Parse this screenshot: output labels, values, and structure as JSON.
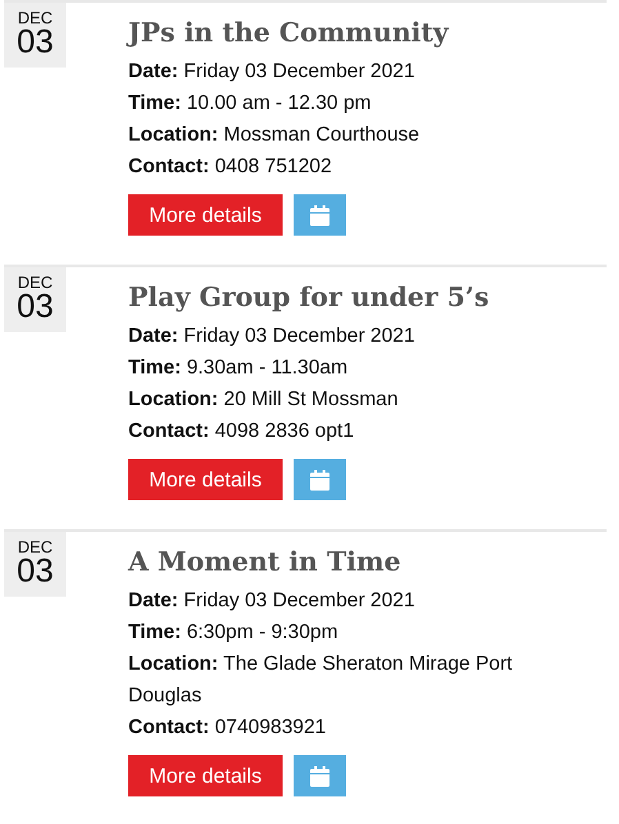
{
  "events": [
    {
      "month": "DEC",
      "day": "03",
      "title": "JPs in the Community",
      "details": [
        "**Date:** Friday 03 December 2021",
        "**Time:** 10.00 am - 12.30 pm",
        "**Location:** Mossman Courthouse",
        "**Contact:** 0408 751202"
      ],
      "button": "More details"
    },
    {
      "month": "DEC",
      "day": "03",
      "title": "Play Group for under 5’s",
      "details": [
        "**Date:** Friday 03 December 2021",
        "**Time:** 9.30am - 11.30am",
        "**Location:** 20 Mill St Mossman",
        "**Contact:** 4098 2836 opt1"
      ],
      "button": "More details"
    },
    {
      "month": "DEC",
      "day": "03",
      "title": "A Moment in Time",
      "details": [
        "**Date:** Friday 03 December 2021",
        "**Time:** 6:30pm - 9:30pm",
        "**Location:** The Glade Sheraton Mirage Port Douglas",
        "**Contact:** 0740983921"
      ],
      "button": "More details"
    }
  ]
}
